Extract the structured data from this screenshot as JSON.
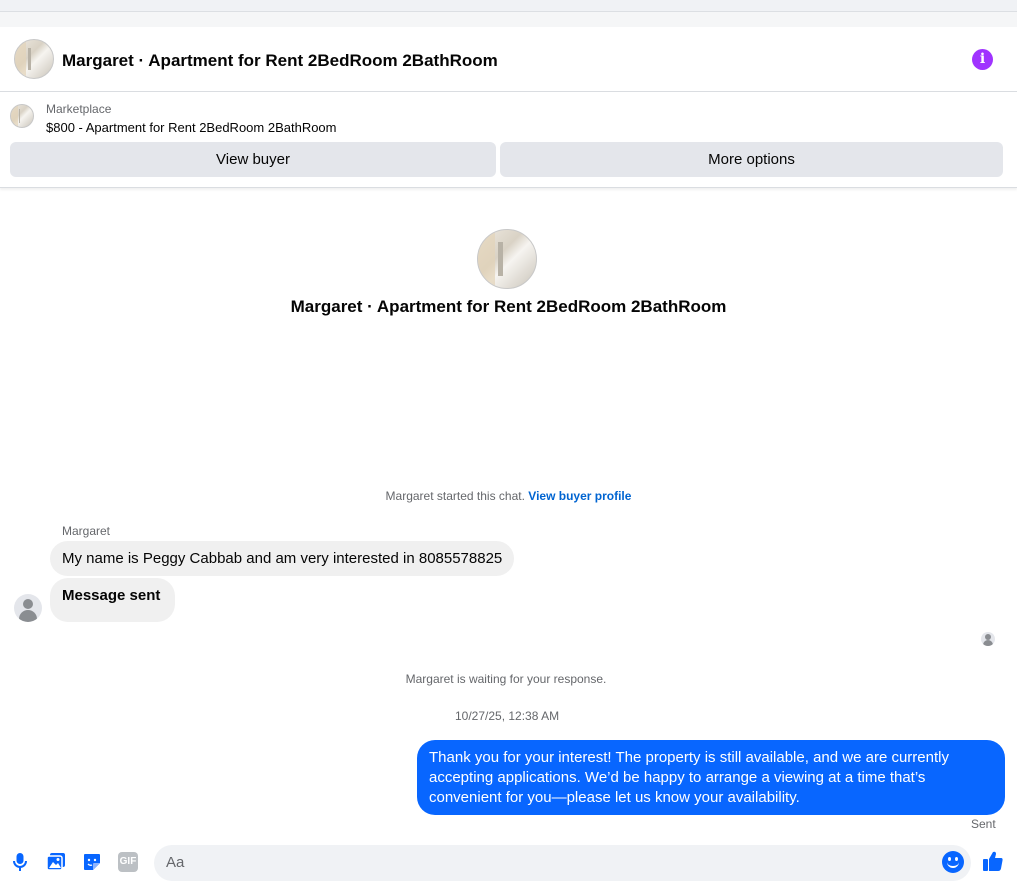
{
  "header": {
    "title": "Margaret · Apartment for Rent 2BedRoom 2BathRoom",
    "info_icon": "info-icon",
    "info_glyph": "i",
    "accent_color": "#a033ff"
  },
  "marketplace": {
    "label": "Marketplace",
    "listing": "$800 - Apartment for Rent 2BedRoom 2BathRoom",
    "view_buyer_label": "View buyer",
    "more_options_label": "More options"
  },
  "intro": {
    "title": "Margaret · Apartment for Rent 2BedRoom 2BathRoom",
    "started_text": "Margaret started this chat.",
    "view_profile_link": "View buyer profile"
  },
  "messages": {
    "sender_name": "Margaret",
    "incoming": [
      "My name is Peggy Cabbab and am very interested in 8085578825",
      "Message sent"
    ],
    "waiting_text": "Margaret is waiting for your response.",
    "timestamp": "10/27/25, 12:38 AM",
    "outgoing": "Thank you for your interest! The property is still available, and we are currently accepting applications. We’d be happy to arrange a viewing at a time that’s convenient for you—please let us know your availability.",
    "outgoing_status": "Sent",
    "outgoing_color": "#0866ff"
  },
  "composer": {
    "placeholder": "Aa",
    "gif_label": "GIF",
    "icons": [
      "microphone-icon",
      "photo-icon",
      "sticker-icon",
      "gif-icon",
      "emoji-icon",
      "like-icon"
    ]
  }
}
